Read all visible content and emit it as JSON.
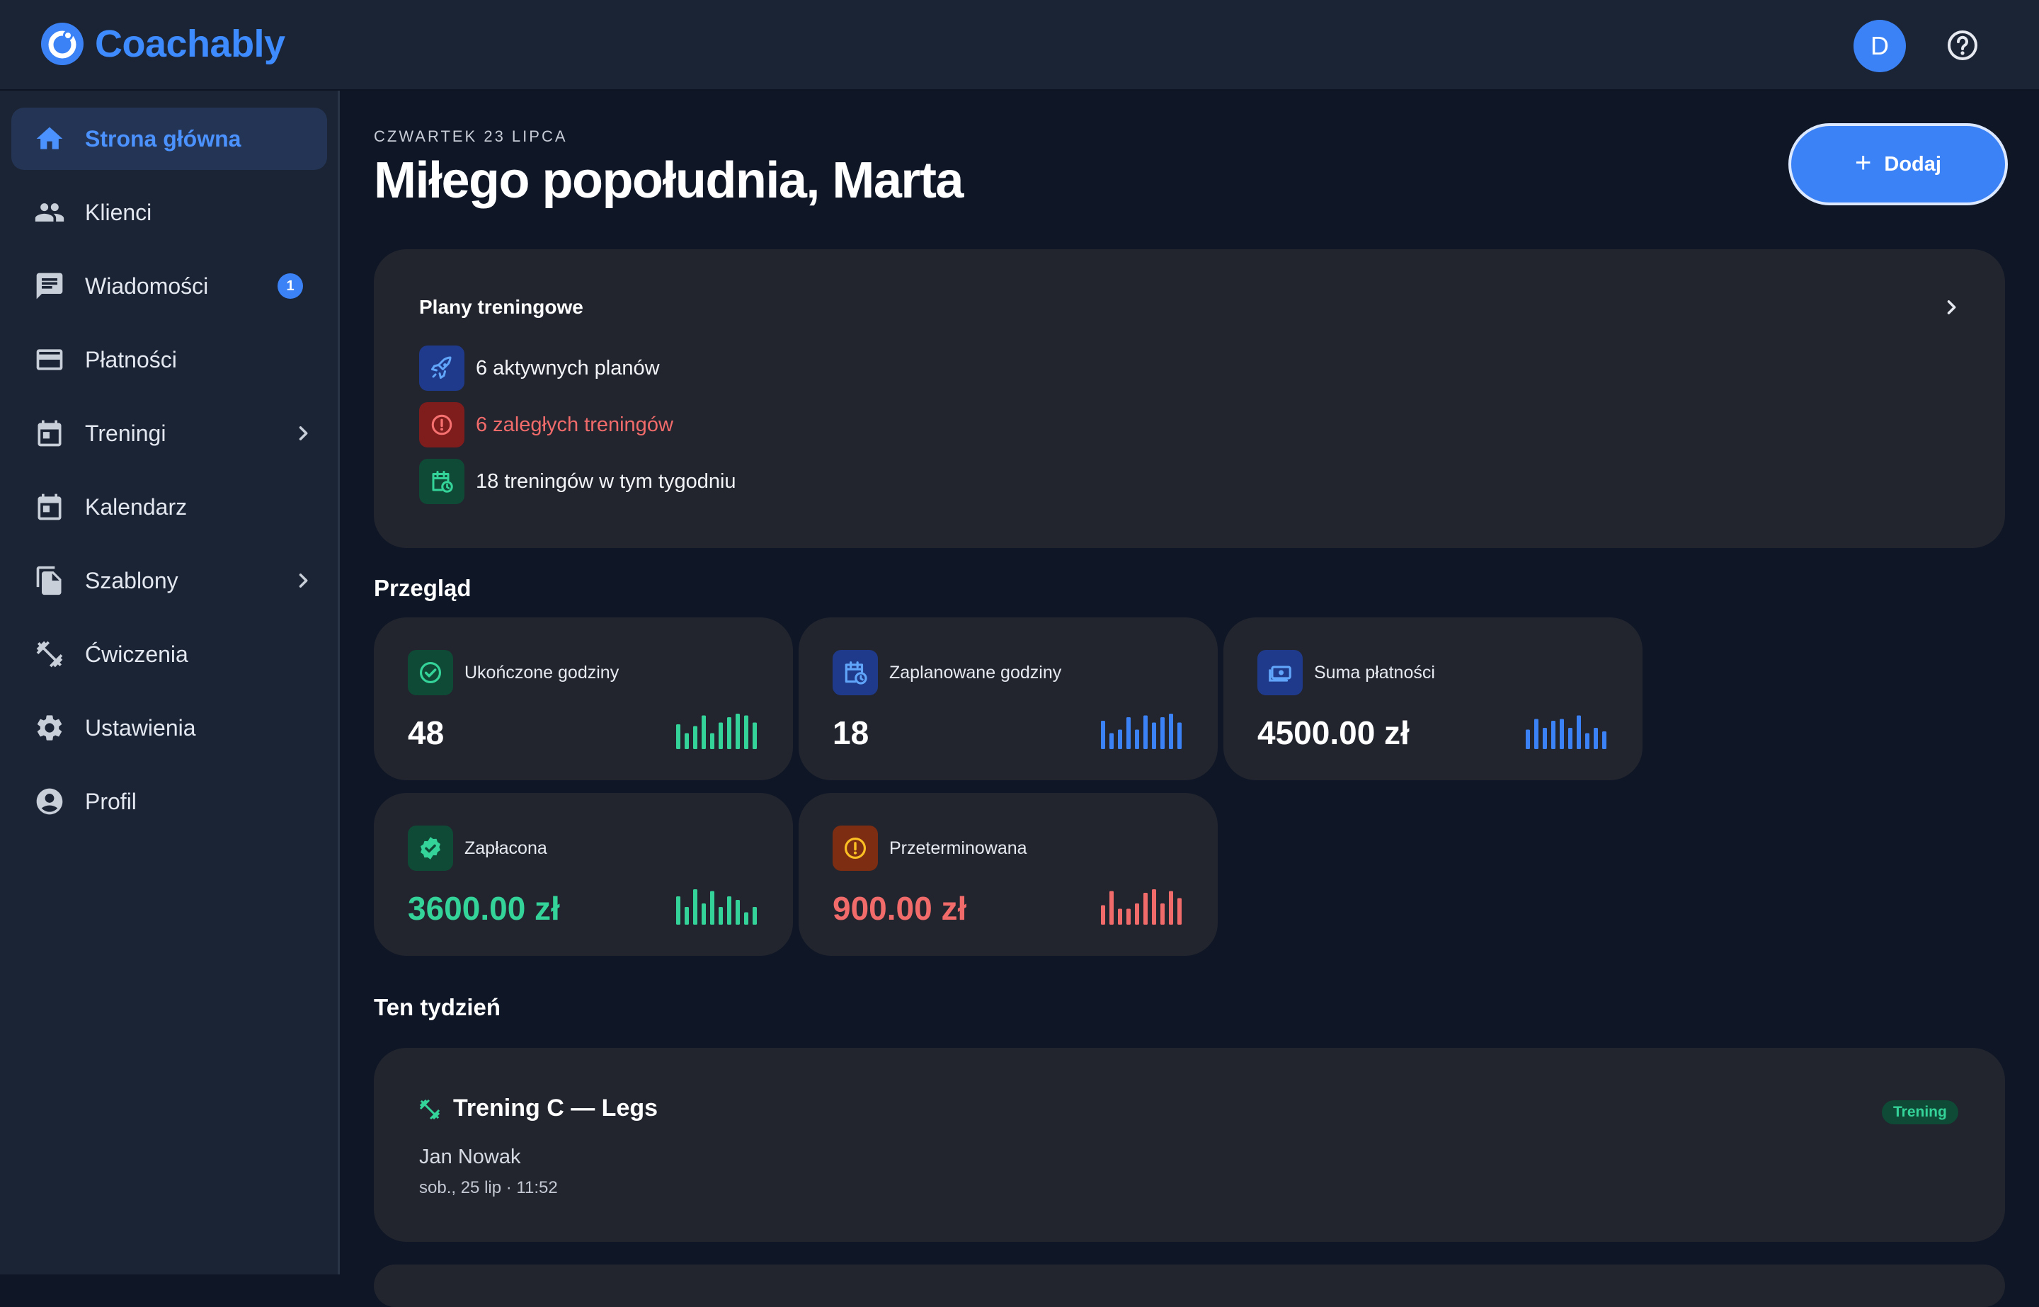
{
  "app": {
    "brand": "Coachably",
    "user_initial": "D",
    "accent": "#3b82f6"
  },
  "sidebar": {
    "items": [
      {
        "label": "Strona główna",
        "icon": "home-icon",
        "active": true
      },
      {
        "label": "Klienci",
        "icon": "people-icon"
      },
      {
        "label": "Wiadomości",
        "icon": "chat-icon",
        "badge": "1"
      },
      {
        "label": "Płatności",
        "icon": "credit-card-icon"
      },
      {
        "label": "Treningi",
        "icon": "calendar-icon",
        "expandable": true
      },
      {
        "label": "Kalendarz",
        "icon": "calendar-icon"
      },
      {
        "label": "Szablony",
        "icon": "files-icon",
        "expandable": true
      },
      {
        "label": "Ćwiczenia",
        "icon": "dumbbell-icon"
      },
      {
        "label": "Ustawienia",
        "icon": "gear-icon"
      },
      {
        "label": "Profil",
        "icon": "account-icon"
      }
    ]
  },
  "header": {
    "date": "CZWARTEK 23 LIPCA",
    "greeting": "Miłego popołudnia, Marta",
    "add_label": "Dodaj"
  },
  "plans": {
    "title": "Plany treningowe",
    "rows": [
      {
        "text": "6 aktywnych planów",
        "icon": "rocket-icon",
        "color": "#3b82f6"
      },
      {
        "text": "6 zaległych treningów",
        "icon": "alert-circle-icon",
        "color": "#ef4444"
      },
      {
        "text": "18 treningów w tym tygodniu",
        "icon": "calendar-clock-icon",
        "color": "#34d399"
      }
    ]
  },
  "overview": {
    "title": "Przegląd",
    "stats": [
      {
        "label": "Ukończone godziny",
        "value": "48",
        "icon": "check-circle-icon",
        "color": "#34d399",
        "spark": [
          0.7,
          0.45,
          0.65,
          0.95,
          0.45,
          0.75,
          0.9,
          1.0,
          0.95,
          0.75
        ]
      },
      {
        "label": "Zaplanowane godziny",
        "value": "18",
        "icon": "calendar-clock-icon",
        "color": "#3b82f6",
        "spark": [
          0.8,
          0.45,
          0.55,
          0.9,
          0.55,
          0.95,
          0.75,
          0.9,
          1.0,
          0.75
        ]
      },
      {
        "label": "Suma płatności",
        "value": "4500.00 zł",
        "icon": "cash-icon",
        "color": "#3b82f6",
        "spark": [
          0.55,
          0.85,
          0.6,
          0.8,
          0.85,
          0.6,
          0.95,
          0.45,
          0.6,
          0.5
        ]
      },
      {
        "label": "Zapłacona",
        "value": "3600.00 zł",
        "icon": "verified-badge-icon",
        "color": "#34d399",
        "spark": [
          0.8,
          0.5,
          1.0,
          0.6,
          0.95,
          0.5,
          0.8,
          0.7,
          0.35,
          0.5
        ]
      },
      {
        "label": "Przeterminowana",
        "value": "900.00 zł",
        "icon": "alert-circle-icon",
        "color": "#f26b6b",
        "spark": [
          0.55,
          0.95,
          0.45,
          0.45,
          0.6,
          0.9,
          1.0,
          0.6,
          0.95,
          0.75
        ]
      }
    ]
  },
  "week": {
    "title": "Ten tydzień",
    "events": [
      {
        "title": "Trening C — Legs",
        "client": "Jan Nowak",
        "time": "sob., 25 lip · 11:52",
        "tag": "Trening",
        "icon": "dumbbell-icon"
      }
    ]
  }
}
